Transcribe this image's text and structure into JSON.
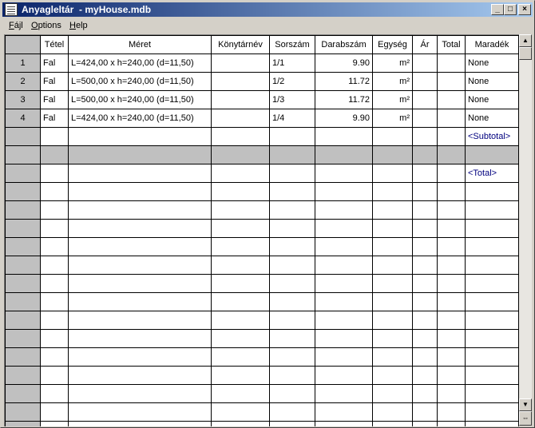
{
  "window": {
    "title": "Anyagleltár  - myHouse.mdb"
  },
  "titlebar_buttons": {
    "minimize": "_",
    "maximize": "□",
    "close": "×"
  },
  "menu": [
    {
      "label": "Fájl",
      "mnemonic": "F",
      "rest": "ájl"
    },
    {
      "label": "Options",
      "mnemonic": "O",
      "rest": "ptions"
    },
    {
      "label": "Help",
      "mnemonic": "H",
      "rest": "elp"
    }
  ],
  "columns": [
    "",
    "Tétel",
    "Méret",
    "Könytárnév",
    "Sorszám",
    "Darabszám",
    "Egység",
    "Ár",
    "Total",
    "Maradék"
  ],
  "rows": [
    {
      "num": "1",
      "tetel": "Fal",
      "meret": "L=424,00 x h=240,00 (d=11,50)",
      "konyvtar": "",
      "sorszam": "1/1",
      "darab": "9.90",
      "egyseg": "m²",
      "ar": "",
      "total": "",
      "maradek": "None"
    },
    {
      "num": "2",
      "tetel": "Fal",
      "meret": "L=500,00 x h=240,00 (d=11,50)",
      "konyvtar": "",
      "sorszam": "1/2",
      "darab": "11.72",
      "egyseg": "m²",
      "ar": "",
      "total": "",
      "maradek": "None"
    },
    {
      "num": "3",
      "tetel": "Fal",
      "meret": "L=500,00 x h=240,00 (d=11,50)",
      "konyvtar": "",
      "sorszam": "1/3",
      "darab": "11.72",
      "egyseg": "m²",
      "ar": "",
      "total": "",
      "maradek": "None"
    },
    {
      "num": "4",
      "tetel": "Fal",
      "meret": "L=424,00 x h=240,00 (d=11,50)",
      "konyvtar": "",
      "sorszam": "1/4",
      "darab": "9.90",
      "egyseg": "m²",
      "ar": "",
      "total": "",
      "maradek": "None"
    }
  ],
  "subtotal_label": "<Subtotal>",
  "total_label": "<Total>",
  "empty_rows": 14,
  "scrollbar": {
    "up": "▲",
    "down": "▼",
    "resize": "⇔"
  }
}
